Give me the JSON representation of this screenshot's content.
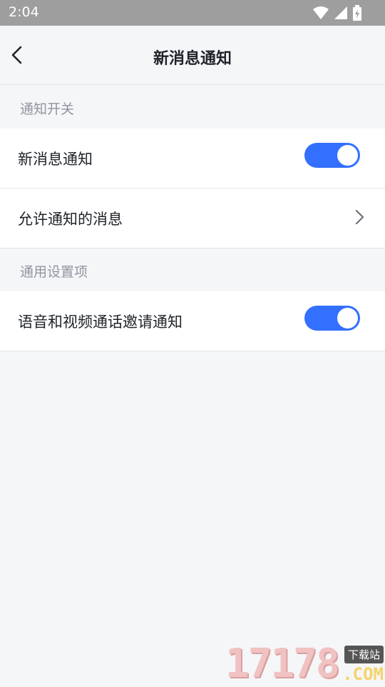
{
  "status_bar": {
    "time": "2:04"
  },
  "navbar": {
    "title": "新消息通知"
  },
  "sections": [
    {
      "header": "通知开关",
      "items": [
        {
          "label": "新消息通知",
          "type": "toggle",
          "on": true
        },
        {
          "label": "允许通知的消息",
          "type": "link"
        }
      ]
    },
    {
      "header": "通用设置项",
      "items": [
        {
          "label": "语音和视频通话邀请通知",
          "type": "toggle",
          "on": true
        }
      ]
    }
  ],
  "watermark": {
    "number": "17178",
    "tag": "下载站",
    "domain": ".COM"
  },
  "colors": {
    "accent": "#3370ff",
    "background": "#f5f6f8",
    "status_bar": "#9e9e9e"
  }
}
